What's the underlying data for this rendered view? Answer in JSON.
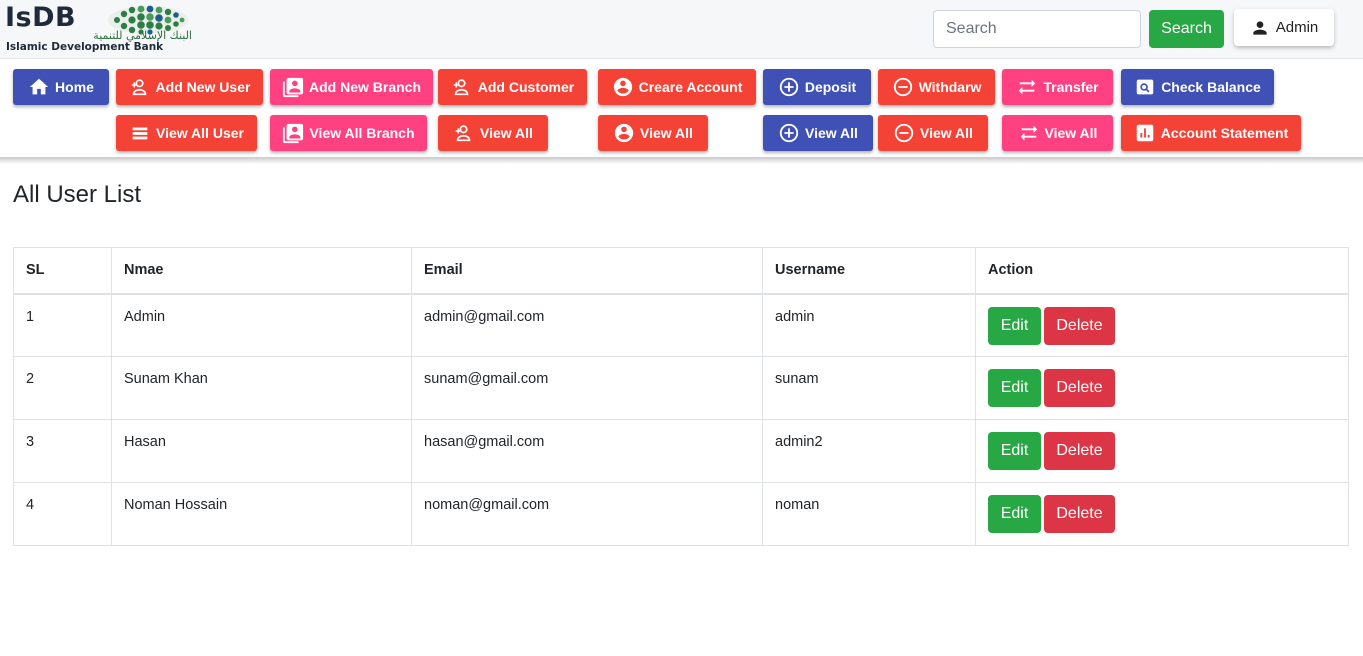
{
  "logo": {
    "title": "IsDB",
    "arabic": "البنك الإسلامي للتنمية",
    "subtitle": "Islamic Development Bank"
  },
  "header": {
    "search_placeholder": "Search",
    "search_button": "Search",
    "user_button": "Admin"
  },
  "menu": {
    "home": "Home",
    "add_new_user": "Add New User",
    "add_new_branch": "Add New Branch",
    "add_customer": "Add Customer",
    "create_account": "Creare Account",
    "deposit": "Deposit",
    "withdraw": "Withdarw",
    "transfer": "Transfer",
    "check_balance": "Check Balance",
    "view_all_user": "View All User",
    "view_all_branch": "View All Branch",
    "view_all_customer": "View All",
    "view_all_account": "View All",
    "view_all_deposit": "View All",
    "view_all_withdraw": "View All",
    "view_all_transfer": "View All",
    "account_statement": "Account Statement"
  },
  "colors": {
    "indigo": "#3f51b5",
    "red": "#f44336",
    "pink": "#ff4081",
    "success": "#28a745",
    "danger": "#dc3545"
  },
  "page": {
    "title": "All User List"
  },
  "table": {
    "headers": [
      "SL",
      "Nmae",
      "Email",
      "Username",
      "Action"
    ],
    "rows": [
      {
        "sl": "1",
        "name": "Admin",
        "email": "admin@gmail.com",
        "username": "admin"
      },
      {
        "sl": "2",
        "name": "Sunam Khan",
        "email": "sunam@gmail.com",
        "username": "sunam"
      },
      {
        "sl": "3",
        "name": "Hasan",
        "email": "hasan@gmail.com",
        "username": "admin2"
      },
      {
        "sl": "4",
        "name": "Noman Hossain",
        "email": "noman@gmail.com",
        "username": "noman"
      }
    ],
    "edit_label": "Edit",
    "delete_label": "Delete"
  },
  "icons": {
    "home": "home-icon",
    "add_user": "person-add-icon",
    "branch": "contacts-icon",
    "account": "account-circle-icon",
    "deposit": "add-circle-icon",
    "withdraw": "remove-circle-icon",
    "transfer": "swap-arrows-icon",
    "balance": "search-box-icon",
    "list": "list-icon",
    "statement": "bar-chart-icon",
    "user": "person-icon"
  }
}
